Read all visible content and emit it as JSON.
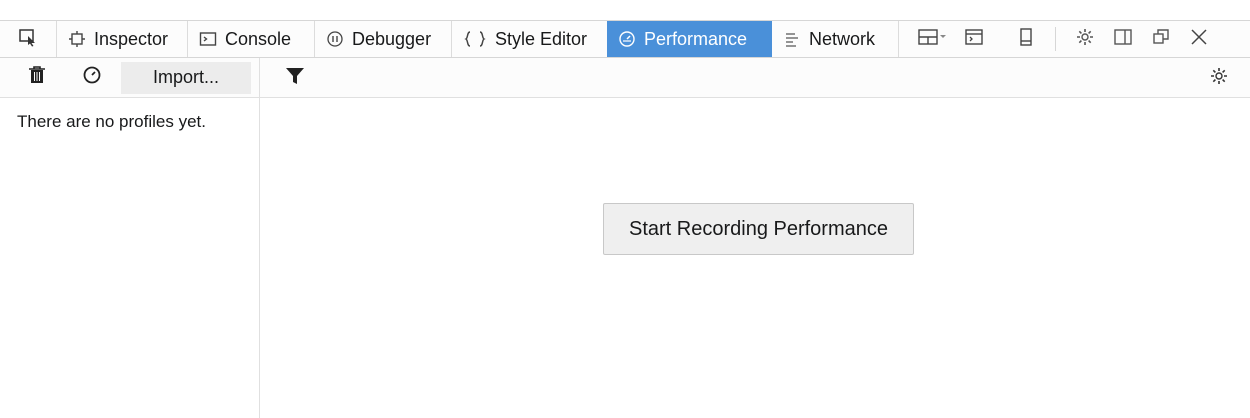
{
  "tabs": [
    {
      "label": "Inspector",
      "icon": "inspector-icon"
    },
    {
      "label": "Console",
      "icon": "console-icon"
    },
    {
      "label": "Debugger",
      "icon": "debugger-icon"
    },
    {
      "label": "Style Editor",
      "icon": "style-editor-icon"
    },
    {
      "label": "Performance",
      "icon": "performance-icon",
      "selected": true
    },
    {
      "label": "Network",
      "icon": "network-icon"
    }
  ],
  "subtoolbar": {
    "import_label": "Import..."
  },
  "sidebar": {
    "empty_text": "There are no profiles yet."
  },
  "main": {
    "record_button_label": "Start Recording Performance"
  },
  "colors": {
    "selected_tab": "#4a90d9",
    "toolbar_bg": "#fcfcfc",
    "button_bg": "#efefef"
  }
}
